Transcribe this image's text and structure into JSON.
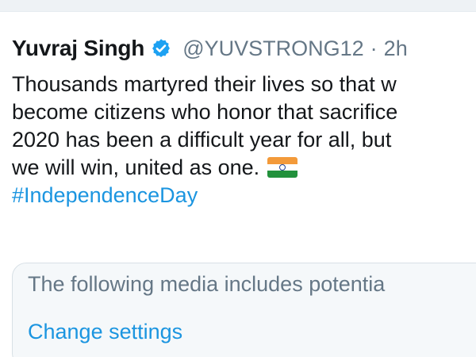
{
  "tweet": {
    "author_name": "Yuvraj Singh",
    "verified_icon": "verified-badge-icon",
    "handle": "@YUVSTRONG12",
    "separator": "·",
    "time": "2h",
    "body_lines": [
      "Thousands martyred their lives so that w",
      "become citizens who honor that sacrifice",
      "2020 has been a difficult year for all, but",
      "we will win, united as one."
    ],
    "flag_icon": "india-flag-icon",
    "hashtag": "#IndependenceDay"
  },
  "media_warning": {
    "text": "The following media includes potentia",
    "link": "Change settings"
  },
  "colors": {
    "link_blue": "#1b95e0",
    "verified_blue": "#1da1f2",
    "secondary_gray": "#657786"
  }
}
